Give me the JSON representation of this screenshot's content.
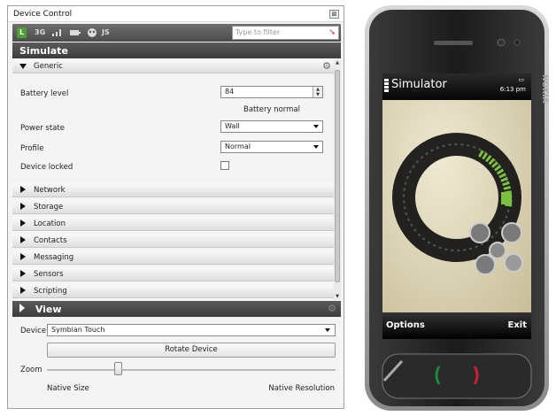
{
  "window": {
    "title": "Device Control",
    "close_glyph": "⊠"
  },
  "toolbar": {
    "icons": [
      "L",
      "3G",
      "signal",
      "battery",
      "globe",
      "JS"
    ],
    "filter_placeholder": "Type to filter"
  },
  "simulate": {
    "title": "Simulate",
    "generic": {
      "label": "Generic",
      "battery_label": "Battery level",
      "battery_value": "84",
      "battery_status": "Battery normal",
      "power_label": "Power state",
      "power_value": "Wall",
      "profile_label": "Profile",
      "profile_value": "Normal",
      "locked_label": "Device locked",
      "locked": false
    },
    "sections": [
      "Network",
      "Storage",
      "Location",
      "Contacts",
      "Messaging",
      "Sensors",
      "Scripting"
    ]
  },
  "view": {
    "title": "View",
    "device_label": "Device",
    "device_value": "Symbian Touch",
    "rotate_label": "Rotate Device",
    "zoom_label": "Zoom",
    "zoom_level": 0.24,
    "zoom_min_label": "Native Size",
    "zoom_max_label": "Native Resolution"
  },
  "phone": {
    "brand": "NOKIA",
    "screen_title": "Simulator",
    "time": "6:13 pm",
    "softkey_left": "Options",
    "softkey_right": "Exit"
  },
  "colors": {
    "header_dark": "#474747",
    "accent_green": "#7bc043",
    "call_green": "#1e8a3c",
    "end_red": "#c8202a"
  }
}
